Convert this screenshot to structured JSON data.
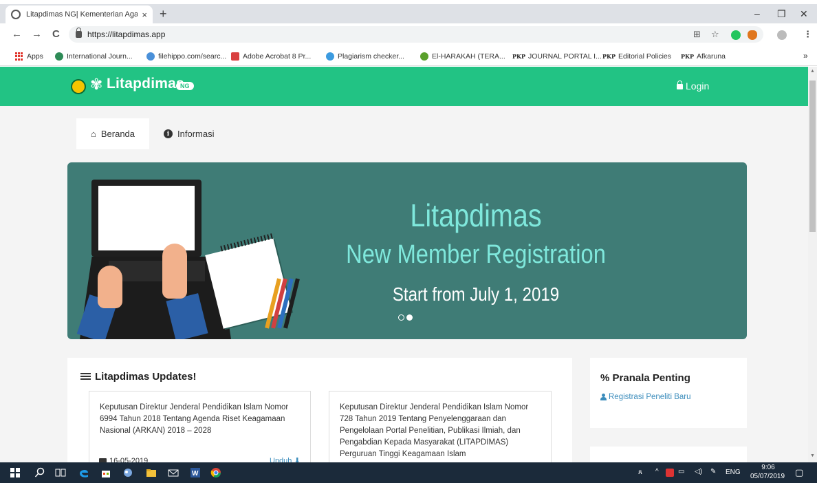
{
  "browser": {
    "tab_title": "Litapdimas NG| Kementerian Aga",
    "tab_close": "×",
    "new_tab": "+",
    "url": "https://litapdimas.app",
    "window_controls": {
      "minimize": "–",
      "restore": "❐",
      "close": "✕"
    },
    "nav": {
      "back": "←",
      "forward": "→",
      "reload": "C"
    },
    "omnibox_icons": {
      "translate": "⊞",
      "star": "☆",
      "menu": "⋮"
    },
    "bookmarks_overflow": "»"
  },
  "bookmarks": [
    {
      "label": "Apps",
      "icon": "apps-grid-icon",
      "color": "#e0342b"
    },
    {
      "label": "International Journ...",
      "icon": "globe-icon",
      "color": "#2e8b57"
    },
    {
      "label": "filehippo.com/searc...",
      "icon": "filehippo-icon",
      "color": "#4a90d9"
    },
    {
      "label": "Adobe Acrobat 8 Pr...",
      "icon": "acrobat-icon",
      "color": "#d94141"
    },
    {
      "label": "Plagiarism checker...",
      "icon": "plagiarism-icon",
      "color": "#3c9be0"
    },
    {
      "label": "El-HARAKAH (TERA...",
      "icon": "harakah-icon",
      "color": "#5aa02c"
    },
    {
      "label": "JOURNAL PORTAL I...",
      "icon": "pkp-icon",
      "prefix": "PKP"
    },
    {
      "label": "Editorial Policies",
      "icon": "pkp-icon",
      "prefix": "PKP"
    },
    {
      "label": "Afkaruna",
      "icon": "pkp-icon",
      "prefix": "PKP"
    }
  ],
  "site": {
    "brand": "Litapdimas",
    "badge": "NG",
    "login": "Login",
    "accent": "#22c384",
    "nav": [
      {
        "label": "Beranda",
        "icon": "home-icon",
        "active": true
      },
      {
        "label": "Informasi",
        "icon": "info-icon",
        "active": false
      }
    ],
    "banner": {
      "line1": "Litapdimas",
      "line2": "New Member Registration",
      "line3": "Start from July 1, 2019",
      "slides": 2,
      "active_slide": 2,
      "bg": "#3f7c76"
    },
    "updates": {
      "title": "Litapdimas Updates!",
      "items": [
        {
          "text": "Keputusan Direktur Jenderal Pendidikan Islam Nomor 6994 Tahun 2018 Tentang Agenda Riset Keagamaan Nasional (ARKAN) 2018 – 2028",
          "date": "16-05-2019",
          "download": "Unduh ⬇"
        },
        {
          "text": "Keputusan Direktur Jenderal Pendidikan Islam Nomor 728 Tahun 2019 Tentang Penyelenggaraan dan Pengelolaan Portal Penelitian, Publikasi Ilmiah, dan Pengabdian Kepada Masyarakat (LITAPDIMAS) Perguruan Tinggi Keagamaan Islam"
        }
      ]
    },
    "pranala": {
      "title": "Pranala Penting",
      "links": [
        "Registrasi Peneliti Baru"
      ]
    }
  },
  "taskbar": {
    "time": "9:06",
    "date": "05/07/2019",
    "lang": "ENG"
  }
}
